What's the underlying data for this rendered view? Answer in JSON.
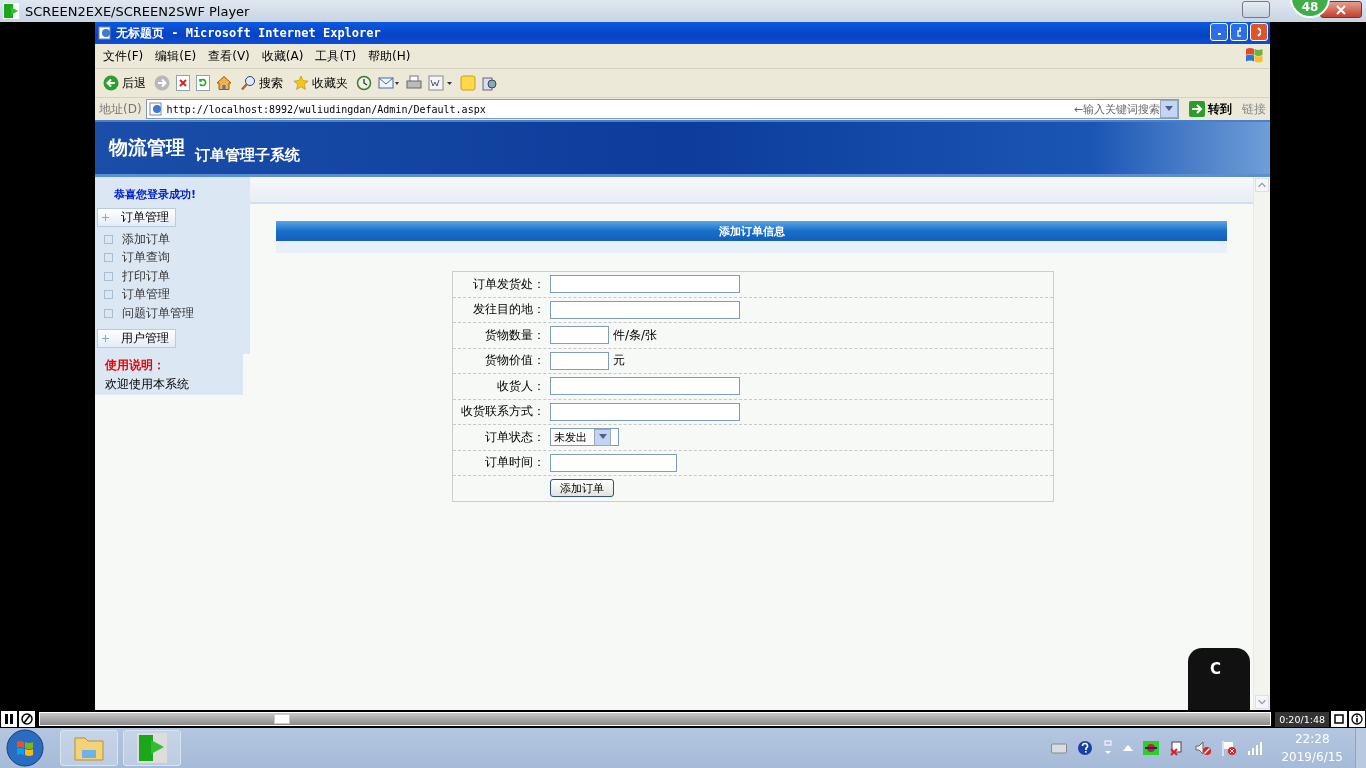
{
  "player": {
    "title": "SCREEN2EXE/SCREEN2SWF Player",
    "badge": "48",
    "time": "0:20/1:48",
    "level": 0.19
  },
  "browser": {
    "title": "无标题页 - Microsoft Internet Explorer",
    "menu": [
      "文件(F)",
      "编辑(E)",
      "查看(V)",
      "收藏(A)",
      "工具(T)",
      "帮助(H)"
    ],
    "toolbar": [
      {
        "kind": "back",
        "label": "后退"
      },
      {
        "kind": "forward"
      },
      {
        "kind": "stop"
      },
      {
        "kind": "refresh"
      },
      {
        "kind": "home"
      },
      {
        "kind": "search",
        "label": "搜索"
      },
      {
        "kind": "favorites",
        "label": "收藏夹"
      },
      {
        "kind": "history"
      },
      {
        "kind": "mail"
      },
      {
        "kind": "print"
      },
      {
        "kind": "edit"
      },
      {
        "kind": "note"
      },
      {
        "kind": "research"
      }
    ],
    "address_label": "地址(D)",
    "url": "http://localhost:8992/wuliudingdan/Admin/Default.aspx",
    "search_placeholder": "←输入关键词搜索",
    "go": "转到",
    "links": "链接"
  },
  "page": {
    "logo": "物流管理",
    "subtitle": "订单管理子系统",
    "sidebar": {
      "welcome": "恭喜您登录成功!",
      "groups": [
        {
          "label": "订单管理",
          "items": [
            "添加订单",
            "订单查询",
            "打印订单",
            "订单管理",
            "问题订单管理"
          ]
        },
        {
          "label": "用户管理"
        }
      ],
      "help_title": "使用说明：",
      "help_text": "欢迎使用本系统"
    },
    "form": {
      "title": "添加订单信息",
      "rows": [
        {
          "kind": "long",
          "label": "订单发货处："
        },
        {
          "kind": "long",
          "label": "发往目的地："
        },
        {
          "kind": "short",
          "label": "货物数量：",
          "unit": "件/条/张"
        },
        {
          "kind": "short",
          "label": "货物价值：",
          "unit": "元"
        },
        {
          "kind": "long",
          "label": "收货人："
        },
        {
          "kind": "long",
          "label": "收货联系方式："
        },
        {
          "kind": "select",
          "label": "订单状态：",
          "value": "未发出"
        },
        {
          "kind": "medium",
          "label": "订单时间："
        }
      ],
      "submit": "添加订单"
    }
  },
  "widget": {
    "letter": "C"
  },
  "taskbar": {
    "time": "22:28",
    "date": "2019/6/15"
  }
}
